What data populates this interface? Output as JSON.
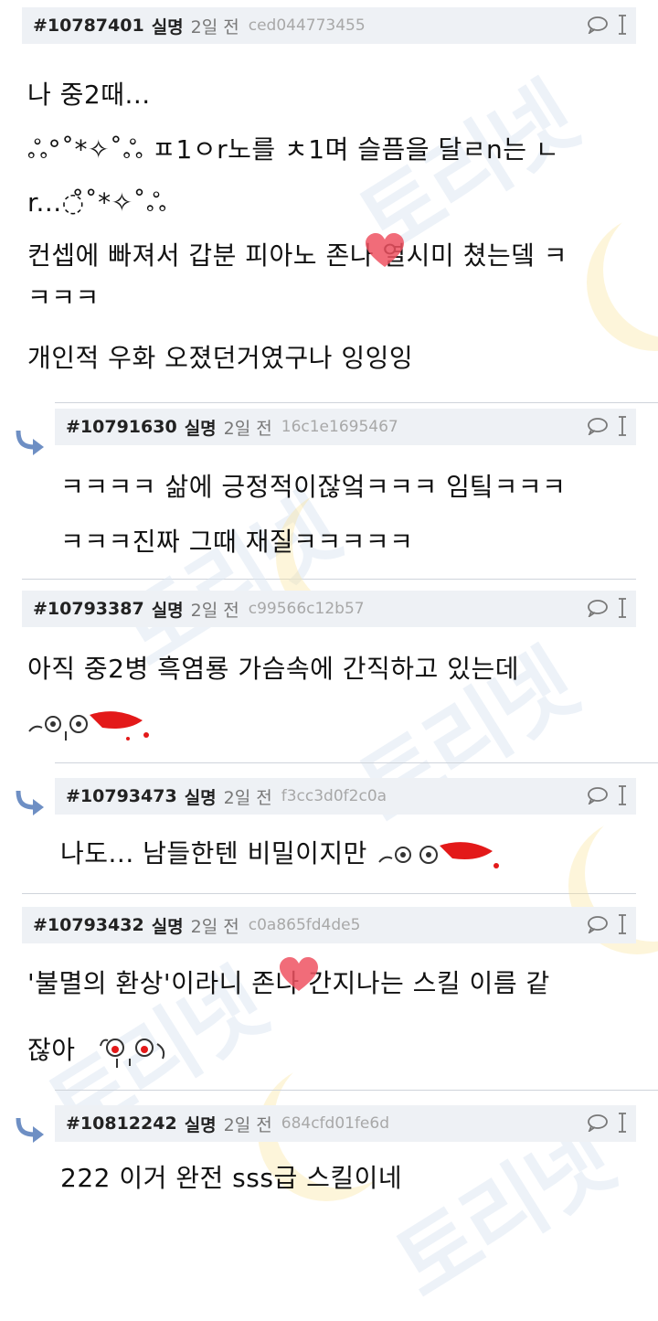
{
  "watermark": "토리넷",
  "threads": [
    {
      "id": "#10787401",
      "author": "실명",
      "time": "2일 전",
      "hash": "ced044773455",
      "lines": [
        "나 중2때...",
        "ஃ°˚*✧˚ஃ ㅍ1ㅇr노를 ㅊ1며 슬픔을 달ㄹn는 ㄴ",
        "r...◌̊˚*✧˚ஃ",
        "컨셉에 빠져서 갑분 피아노 존나 열시미 쳤는뎈 ㅋ",
        "ㅋㅋㅋ",
        "개인적 우화 오졌던거였구나 잉잉잉"
      ]
    },
    {
      "id": "#10791630",
      "author": "실명",
      "time": "2일 전",
      "hash": "16c1e1695467",
      "lines": [
        "ㅋㅋㅋㅋ 삶에 긍정적이잖엌ㅋㅋㅋ 임팈ㅋㅋㅋ",
        "ㅋㅋㅋ진짜 그때 재질ㅋㅋㅋㅋㅋ"
      ]
    },
    {
      "id": "#10793387",
      "author": "실명",
      "time": "2일 전",
      "hash": "c99566c12b57",
      "lines": [
        "아직 중2병 흑염룡 가슴속에 간직하고 있는데"
      ]
    },
    {
      "id": "#10793473",
      "author": "실명",
      "time": "2일 전",
      "hash": "f3cc3d0f2c0a",
      "lines": [
        "나도... 남들한텐 비밀이지만"
      ]
    },
    {
      "id": "#10793432",
      "author": "실명",
      "time": "2일 전",
      "hash": "c0a865fd4de5",
      "lines": [
        "'불멸의 환상'이라니 존나 간지나는 스킬 이름 같",
        "잖아"
      ]
    },
    {
      "id": "#10812242",
      "author": "실명",
      "time": "2일 전",
      "hash": "684cfd01fe6d",
      "lines": [
        "222 이거 완전 sss급 스킬이네"
      ]
    }
  ],
  "icons": [
    "comment-icon",
    "text-cursor-icon",
    "reply-arrow-icon"
  ]
}
